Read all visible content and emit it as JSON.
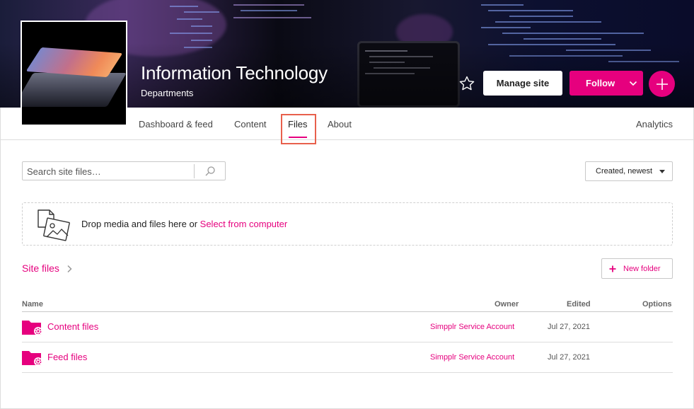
{
  "site": {
    "title": "Information Technology",
    "subtitle": "Departments"
  },
  "header_actions": {
    "manage_label": "Manage site",
    "follow_label": "Follow"
  },
  "tabs": [
    {
      "label": "Dashboard & feed"
    },
    {
      "label": "Content"
    },
    {
      "label": "Files"
    },
    {
      "label": "About"
    }
  ],
  "analytics_label": "Analytics",
  "search": {
    "placeholder": "Search site files…",
    "value": ""
  },
  "sort": {
    "selected": "Created, newest"
  },
  "dropzone": {
    "text": "Drop media and files here or ",
    "link": "Select from computer"
  },
  "breadcrumb": {
    "label": "Site files"
  },
  "new_folder_label": "New folder",
  "table": {
    "columns": [
      "Name",
      "Owner",
      "Edited",
      "Options"
    ],
    "rows": [
      {
        "name": "Content files",
        "owner": "Simpplr Service Account",
        "edited": "Jul 27, 2021"
      },
      {
        "name": "Feed files",
        "owner": "Simpplr Service Account",
        "edited": "Jul 27, 2021"
      }
    ]
  },
  "colors": {
    "accent": "#e6007e",
    "highlight": "#e8604c"
  },
  "icons": [
    "star-icon",
    "chevron-down-icon",
    "plus-icon",
    "search-icon",
    "caret-down-icon",
    "media-upload-icon",
    "chevron-right-icon",
    "folder-gear-icon"
  ]
}
